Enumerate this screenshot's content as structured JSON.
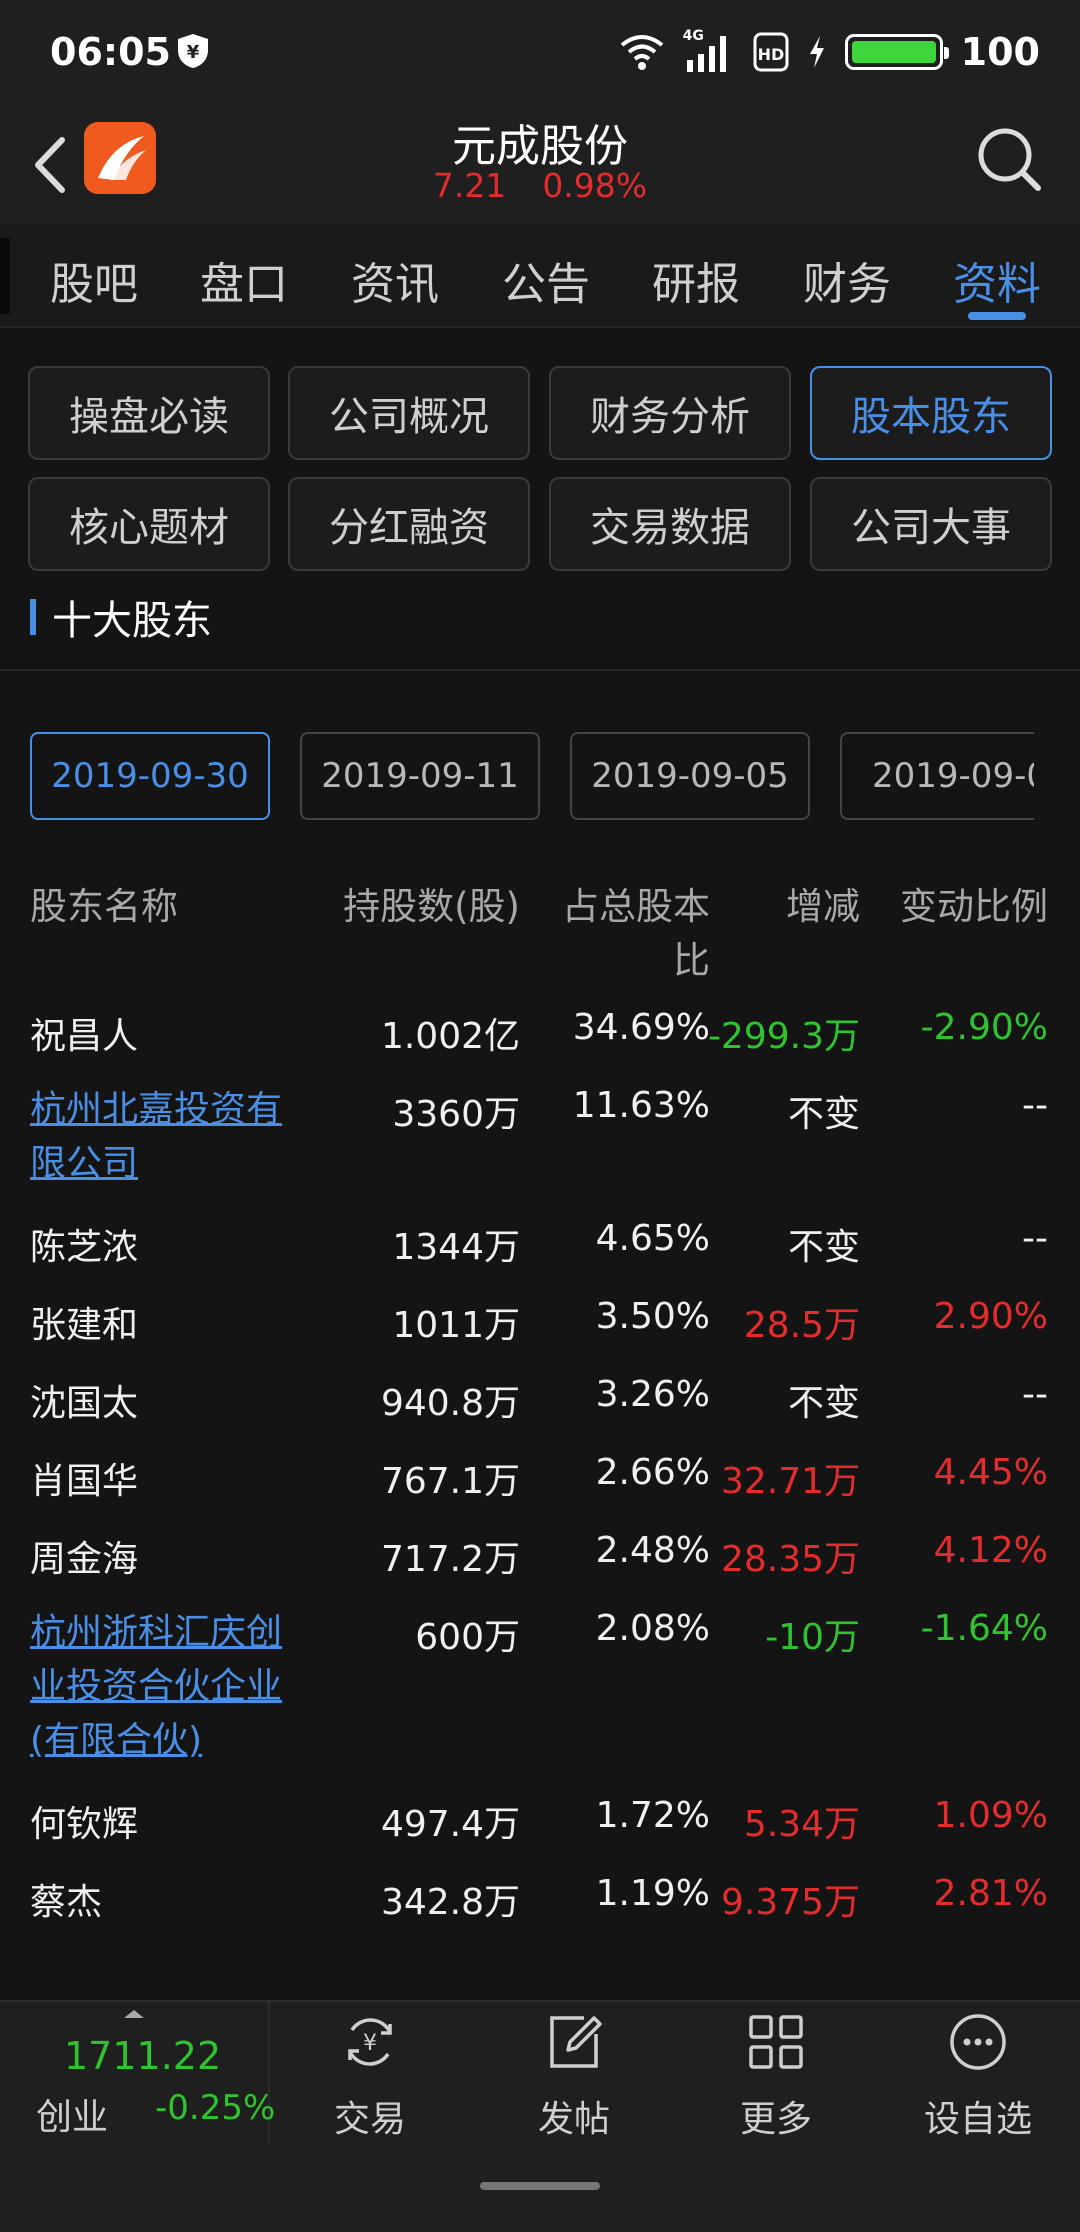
{
  "status_bar": {
    "time": "06:05",
    "network": "4G",
    "battery_level": "100",
    "icons": [
      "shield-icon",
      "wifi-icon",
      "signal-icon",
      "hd-icon",
      "charging-icon",
      "battery-icon"
    ]
  },
  "header": {
    "title": "元成股份",
    "price": "7.21",
    "change": "0.98%",
    "price_color": "#e52c2c"
  },
  "tabs": [
    "股吧",
    "盘口",
    "资讯",
    "公告",
    "研报",
    "财务",
    "资料"
  ],
  "active_tab": "资料",
  "grid_buttons": [
    "操盘必读",
    "公司概况",
    "财务分析",
    "股本股东",
    "核心题材",
    "分红融资",
    "交易数据",
    "公司大事"
  ],
  "active_grid_button": "股本股东",
  "section_title": "十大股东",
  "dates": [
    "2019-09-30",
    "2019-09-11",
    "2019-09-05",
    "2019-09-0"
  ],
  "active_date": "2019-09-30",
  "table": {
    "headers": {
      "name": "股东名称",
      "shares": "持股数(股)",
      "ratio_line1": "占总股本",
      "ratio_line2": "比",
      "change": "增减",
      "change_ratio": "变动比例"
    },
    "rows": [
      {
        "name": "祝昌人",
        "shares": "1.002亿",
        "ratio": "34.69%",
        "change": "-299.3万",
        "change_ratio": "-2.90%",
        "trend": "down",
        "link": false
      },
      {
        "name": "杭州北嘉投资有限公司",
        "shares": "3360万",
        "ratio": "11.63%",
        "change": "不变",
        "change_ratio": "--",
        "trend": "flat",
        "link": true
      },
      {
        "name": "陈芝浓",
        "shares": "1344万",
        "ratio": "4.65%",
        "change": "不变",
        "change_ratio": "--",
        "trend": "flat",
        "link": false
      },
      {
        "name": "张建和",
        "shares": "1011万",
        "ratio": "3.50%",
        "change": "28.5万",
        "change_ratio": "2.90%",
        "trend": "up",
        "link": false
      },
      {
        "name": "沈国太",
        "shares": "940.8万",
        "ratio": "3.26%",
        "change": "不变",
        "change_ratio": "--",
        "trend": "flat",
        "link": false
      },
      {
        "name": "肖国华",
        "shares": "767.1万",
        "ratio": "2.66%",
        "change": "32.71万",
        "change_ratio": "4.45%",
        "trend": "up",
        "link": false
      },
      {
        "name": "周金海",
        "shares": "717.2万",
        "ratio": "2.48%",
        "change": "28.35万",
        "change_ratio": "4.12%",
        "trend": "up",
        "link": false
      },
      {
        "name": "杭州浙科汇庆创业投资合伙企业(有限合伙)",
        "shares": "600万",
        "ratio": "2.08%",
        "change": "-10万",
        "change_ratio": "-1.64%",
        "trend": "down",
        "link": true
      },
      {
        "name": "何钦辉",
        "shares": "497.4万",
        "ratio": "1.72%",
        "change": "5.34万",
        "change_ratio": "1.09%",
        "trend": "up",
        "link": false
      },
      {
        "name": "蔡杰",
        "shares": "342.8万",
        "ratio": "1.19%",
        "change": "9.375万",
        "change_ratio": "2.81%",
        "trend": "up",
        "link": false
      }
    ]
  },
  "bottom_bar": {
    "index_value": "1711.22",
    "index_name": "创业",
    "index_change": "-0.25%",
    "nav": [
      {
        "label": "交易",
        "icon": "trade-icon"
      },
      {
        "label": "发帖",
        "icon": "compose-icon"
      },
      {
        "label": "更多",
        "icon": "grid-icon"
      },
      {
        "label": "设自选",
        "icon": "more-icon"
      }
    ]
  }
}
